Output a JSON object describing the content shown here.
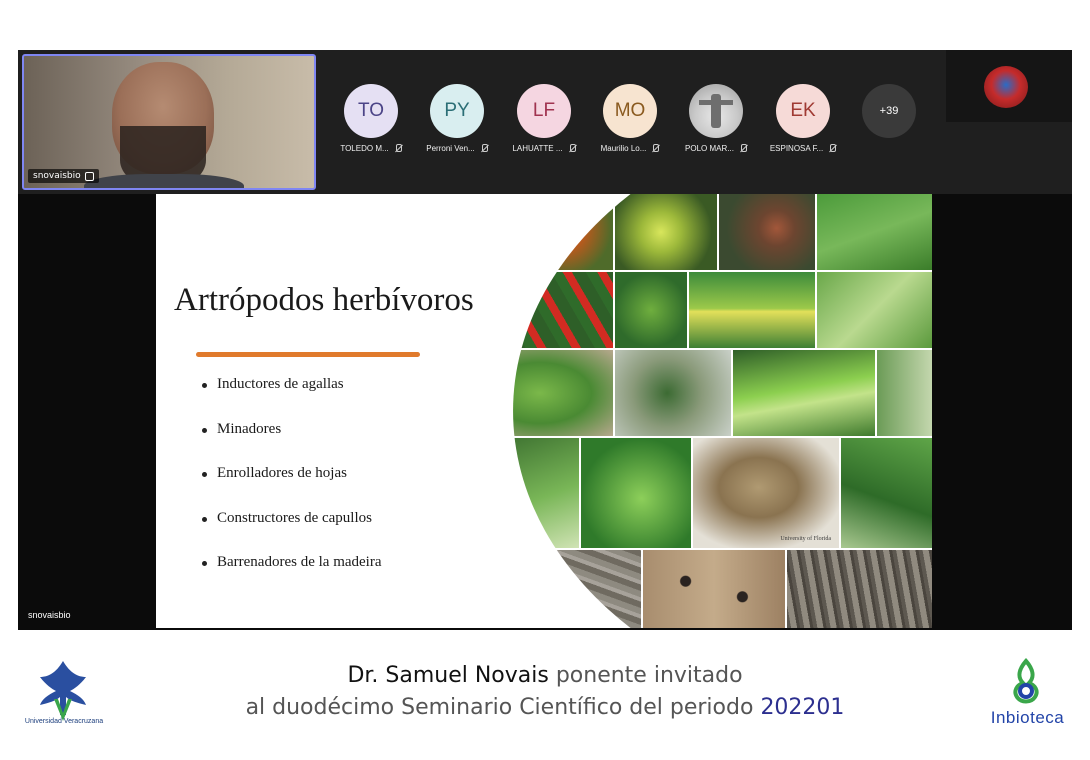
{
  "self_view": {
    "name": "snovaisbio"
  },
  "participants": [
    {
      "initials": "TO",
      "name": "TOLEDO M...",
      "bg": "#e5e0f3",
      "fg": "#4b4487"
    },
    {
      "initials": "PY",
      "name": "Perroni Ven...",
      "bg": "#d9eef0",
      "fg": "#2b6e76"
    },
    {
      "initials": "LF",
      "name": "LAHUATTE ...",
      "bg": "#f5d6e1",
      "fg": "#a0334f"
    },
    {
      "initials": "MO",
      "name": "Maurilio Lo...",
      "bg": "#f7e4d0",
      "fg": "#8a5a1f"
    },
    {
      "initials": "",
      "name": "POLO MAR...",
      "bg": "#cfcfcf",
      "fg": "#333333"
    },
    {
      "initials": "EK",
      "name": "ESPINOSA F...",
      "bg": "#f6dad7",
      "fg": "#a03a33"
    }
  ],
  "more_count": "+39",
  "share": {
    "presenter_name": "snovaisbio"
  },
  "slide": {
    "title": "Artrópodos herbívoros",
    "bullets": [
      "Inductores de agallas",
      "Minadores",
      "Enrolladores de hojas",
      "Constructores de capullos",
      "Barrenadores de la madeira"
    ],
    "photo_credit": "University of Florida"
  },
  "caption": {
    "line1_name": "Dr. Samuel Novais",
    "line1_rest": " ponente invitado",
    "line2_text": "al duodécimo Seminario Científico del periodo ",
    "line2_period": "202201"
  },
  "logos": {
    "left_text": "Universidad Veracruzana",
    "right_text": "Inbioteca"
  },
  "colors": {
    "accent_border": "#7f86f3",
    "underline": "#e07a2c",
    "caption_blue": "#2c2f8f",
    "logo_blue": "#2244a8",
    "logo_green": "#3aa64a"
  }
}
